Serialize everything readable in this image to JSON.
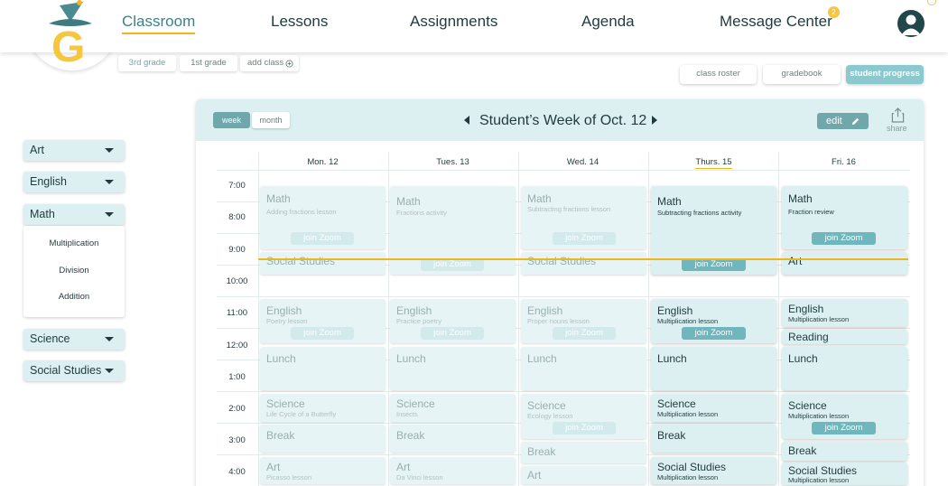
{
  "nav": {
    "items": [
      "Classroom",
      "Lessons",
      "Assignments",
      "Agenda",
      "Message Center"
    ],
    "message_count": "2"
  },
  "class_tabs": [
    "3rd grade",
    "1st grade",
    "add class"
  ],
  "sub_tabs": [
    "class roster",
    "gradebook",
    "student progress"
  ],
  "sidebar": {
    "subjects": [
      "Art",
      "English",
      "Math",
      "Science",
      "Social Studies"
    ],
    "math_subitems": [
      "Multiplication",
      "Division",
      "Addition"
    ]
  },
  "calendar": {
    "view_options": [
      "week",
      "month"
    ],
    "title": "Student’s Week of Oct. 12",
    "edit_label": "edit",
    "share_label": "share",
    "days": [
      "Mon. 12",
      "Tues. 13",
      "Wed. 14",
      "Thurs. 15",
      "Fri. 16"
    ],
    "times": [
      "7:00",
      "8:00",
      "9:00",
      "10:00",
      "11:00",
      "12:00",
      "1:00",
      "2:00",
      "3:00",
      "4:00"
    ],
    "zoom_label": "join Zoom",
    "events": {
      "mon": [
        {
          "title": "Math",
          "sub": "Adding fractions lesson"
        },
        {
          "title": "Social Studies"
        },
        {
          "title": "English",
          "sub": "Poetry lesson"
        },
        {
          "title": "Lunch"
        },
        {
          "title": "Science",
          "sub": "Life Cycle of a Butterfly"
        },
        {
          "title": "Break"
        },
        {
          "title": "Art",
          "sub": "Picasso lesson"
        }
      ],
      "tue": [
        {
          "title": "Math",
          "sub": "Fractions activity"
        },
        {
          "title": "English",
          "sub": "Practice poetry"
        },
        {
          "title": "Lunch"
        },
        {
          "title": "Science",
          "sub": "Insects"
        },
        {
          "title": "Break"
        },
        {
          "title": "Art",
          "sub": "Da Vinci lesson"
        }
      ],
      "wed": [
        {
          "title": "Math",
          "sub": "Subtracting fractions lesson"
        },
        {
          "title": "Social Studies"
        },
        {
          "title": "English",
          "sub": "Proper nouns lesson"
        },
        {
          "title": "Lunch"
        },
        {
          "title": "Science",
          "sub": "Ecology lesson"
        },
        {
          "title": "Break"
        },
        {
          "title": "Art"
        }
      ],
      "thu": [
        {
          "title": "Math",
          "sub": "Subtracting fractions activity"
        },
        {
          "title": "English",
          "sub": "Multiplication lesson"
        },
        {
          "title": "Lunch"
        },
        {
          "title": "Science",
          "sub": "Multiplication lesson"
        },
        {
          "title": "Break"
        },
        {
          "title": "Social Studies",
          "sub": "Multiplication lesson"
        }
      ],
      "fri": [
        {
          "title": "Math",
          "sub": "Fraction review"
        },
        {
          "title": "Art"
        },
        {
          "title": "English",
          "sub": "Multiplication lesson"
        },
        {
          "title": "Reading"
        },
        {
          "title": "Lunch"
        },
        {
          "title": "Science",
          "sub": "Multiplication lesson"
        },
        {
          "title": "Break"
        },
        {
          "title": "Social Studies",
          "sub": "Multiplication lesson"
        }
      ]
    }
  },
  "colors": {
    "accent_teal": "#6fa7ab",
    "light_teal": "#dcf0f1",
    "highlight_yellow": "#f0b51b",
    "text_dark": "#1f3b3d"
  }
}
